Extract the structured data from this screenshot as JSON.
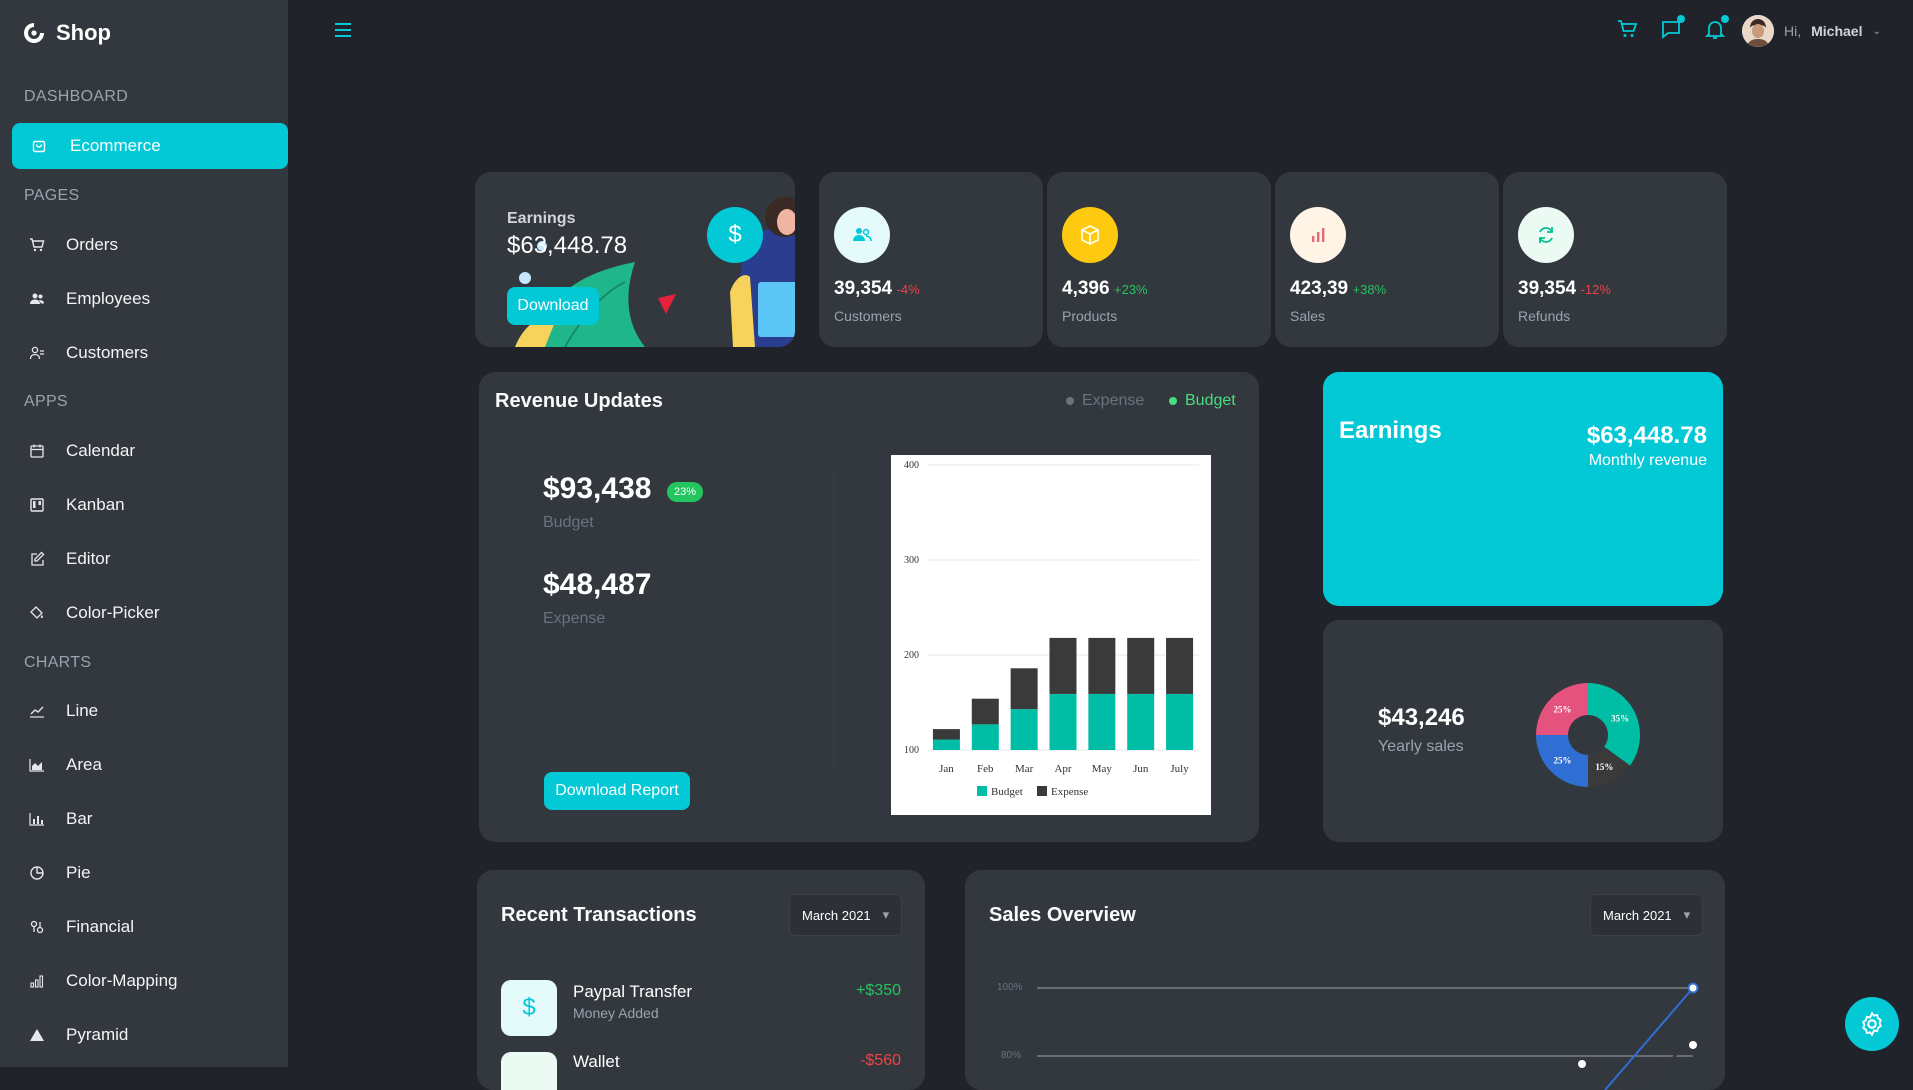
{
  "brand": {
    "name": "Shop",
    "logo_icon": "shop-logo-icon"
  },
  "sidebar": {
    "sections": [
      {
        "title": "DASHBOARD",
        "items": [
          {
            "label": "Ecommerce",
            "icon": "shopping-bag-icon",
            "active": true
          }
        ]
      },
      {
        "title": "PAGES",
        "items": [
          {
            "label": "Orders",
            "icon": "cart-icon"
          },
          {
            "label": "Employees",
            "icon": "users-icon"
          },
          {
            "label": "Customers",
            "icon": "user-icon"
          }
        ]
      },
      {
        "title": "APPS",
        "items": [
          {
            "label": "Calendar",
            "icon": "calendar-icon"
          },
          {
            "label": "Kanban",
            "icon": "kanban-icon"
          },
          {
            "label": "Editor",
            "icon": "edit-icon"
          },
          {
            "label": "Color-Picker",
            "icon": "brush-icon"
          }
        ]
      },
      {
        "title": "CHARTS",
        "items": [
          {
            "label": "Line",
            "icon": "line-chart-icon"
          },
          {
            "label": "Area",
            "icon": "area-chart-icon"
          },
          {
            "label": "Bar",
            "icon": "bar-chart-icon"
          },
          {
            "label": "Pie",
            "icon": "pie-chart-icon"
          },
          {
            "label": "Financial",
            "icon": "financial-icon"
          },
          {
            "label": "Color-Mapping",
            "icon": "color-mapping-icon"
          },
          {
            "label": "Pyramid",
            "icon": "pyramid-icon"
          }
        ]
      }
    ]
  },
  "topbar": {
    "greeting": "Hi,",
    "user_name": "Michael"
  },
  "earnings_card": {
    "label": "Earnings",
    "value": "$63,448.78",
    "button": "Download"
  },
  "stats": [
    {
      "value": "39,354",
      "change": "-4%",
      "label": "Customers",
      "icon": "customers-icon",
      "icon_bg": "#e5fafb",
      "icon_color": "#03c9d7",
      "change_color": "#ef4444"
    },
    {
      "value": "4,396",
      "change": "+23%",
      "label": "Products",
      "icon": "box-icon",
      "icon_bg": "#fec90f",
      "icon_color": "#ffffff",
      "change_color": "#22c55e"
    },
    {
      "value": "423,39",
      "change": "+38%",
      "label": "Sales",
      "icon": "bar-chart-icon",
      "icon_bg": "#fff4e5",
      "icon_color": "#e46a76",
      "change_color": "#22c55e"
    },
    {
      "value": "39,354",
      "change": "-12%",
      "label": "Refunds",
      "icon": "refresh-icon",
      "icon_bg": "#ebfaf2",
      "icon_color": "#00c292",
      "change_color": "#ef4444"
    }
  ],
  "revenue": {
    "title": "Revenue Updates",
    "legend_expense": "Expense",
    "legend_budget": "Budget",
    "budget_value": "$93,438",
    "budget_badge": "23%",
    "budget_label": "Budget",
    "expense_value": "$48,487",
    "expense_label": "Expense",
    "button": "Download Report"
  },
  "chart_data": {
    "type": "bar",
    "stacked": true,
    "categories": [
      "Jan",
      "Feb",
      "Mar",
      "Apr",
      "May",
      "Jun",
      "July"
    ],
    "series": [
      {
        "name": "Budget",
        "values": [
          111,
          127,
          143,
          159,
          159,
          159,
          159
        ],
        "color": "#00bda5"
      },
      {
        "name": "Expense",
        "values": [
          111,
          127,
          143,
          159,
          159,
          159,
          159
        ],
        "color": "#3a3a3a"
      }
    ],
    "ylim": [
      100,
      400
    ],
    "yticks": [
      100,
      200,
      300,
      400
    ],
    "grid": true,
    "legend": "bottom"
  },
  "earnings_panel": {
    "title": "Earnings",
    "value": "$63,448.78",
    "subtitle": "Monthly revenue"
  },
  "yearly": {
    "value": "$43,246",
    "label": "Yearly sales",
    "pie": [
      {
        "label": "35%",
        "value": 35,
        "color": "#00bda5"
      },
      {
        "label": "15%",
        "value": 15,
        "color": "#3a3a3a"
      },
      {
        "label": "25%",
        "value": 25,
        "color": "#2f6fd4"
      },
      {
        "label": "25%",
        "value": 25,
        "color": "#e6527e"
      }
    ]
  },
  "transactions": {
    "title": "Recent Transactions",
    "filter": "March 2021",
    "items": [
      {
        "title": "Paypal Transfer",
        "desc": "Money Added",
        "amount": "+$350",
        "amount_color": "#22c55e",
        "icon": "dollar-icon"
      },
      {
        "title": "Wallet",
        "desc": "",
        "amount": "-$560",
        "amount_color": "#ef4444",
        "icon": "wallet-icon"
      }
    ]
  },
  "sales_overview": {
    "title": "Sales Overview",
    "filter": "March 2021",
    "yticks": [
      "100%",
      "80%"
    ]
  }
}
